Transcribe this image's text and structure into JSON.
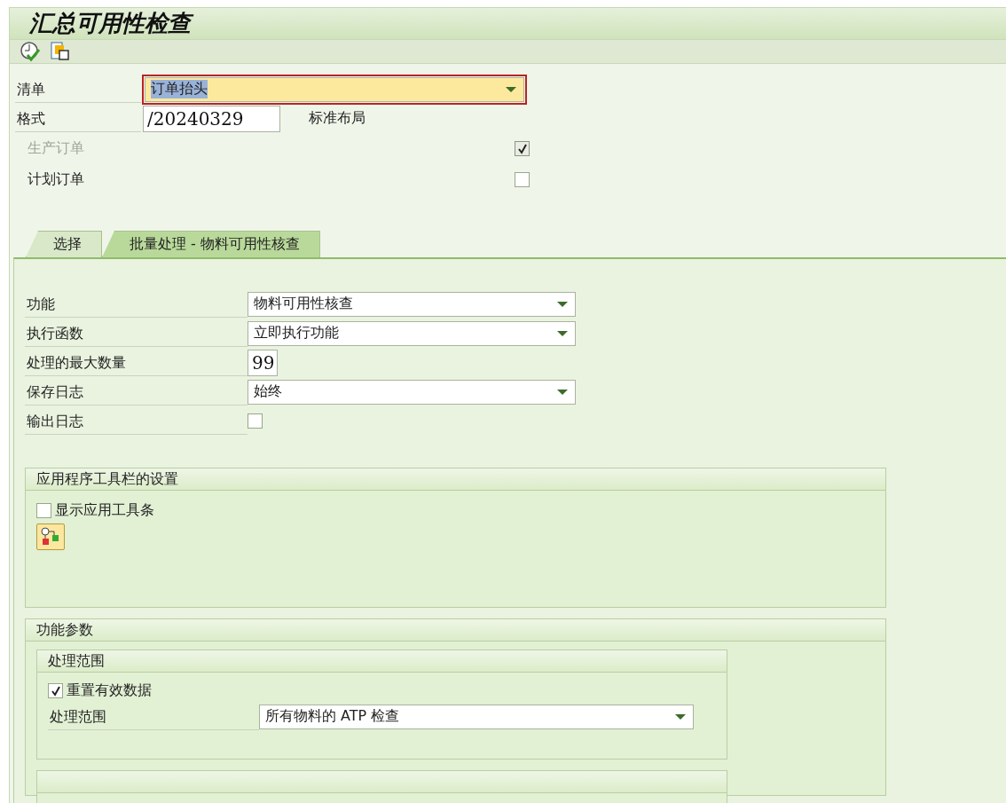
{
  "window": {
    "title": "汇总可用性检查"
  },
  "header_fields": [
    {
      "kind": "dropdown",
      "label": "清单",
      "value": "订单抬头",
      "focused": true
    },
    {
      "kind": "input",
      "label": "格式",
      "value": "/20240329",
      "description": "标准布局"
    }
  ],
  "order_types": [
    {
      "label": "生产订单",
      "checked": true,
      "disabled": true
    },
    {
      "label": "计划订单",
      "checked": false,
      "disabled": false
    }
  ],
  "tabs": [
    {
      "label": "选择",
      "selected": false
    },
    {
      "label": "批量处理 - 物料可用性核查",
      "selected": true
    }
  ],
  "tab_fields": [
    {
      "kind": "dropdown",
      "label": "功能",
      "value": "物料可用性核查"
    },
    {
      "kind": "dropdown",
      "label": "执行函数",
      "value": "立即执行功能"
    },
    {
      "kind": "input",
      "label": "处理的最大数量",
      "value": "99"
    },
    {
      "kind": "dropdown",
      "label": "保存日志",
      "value": "始终"
    },
    {
      "kind": "checkbox",
      "label": "输出日志",
      "checked": false
    }
  ],
  "app_toolbar_group": {
    "title": "应用程序工具栏的设置",
    "checkbox": {
      "label": "显示应用工具条",
      "checked": false
    }
  },
  "function_params_group": {
    "title": "功能参数",
    "subgroup": {
      "title": "处理范围",
      "checkbox": {
        "label": "重置有效数据",
        "checked": true
      },
      "field": {
        "label": "处理范围",
        "value": "所有物料的 ATP 检查"
      }
    }
  }
}
